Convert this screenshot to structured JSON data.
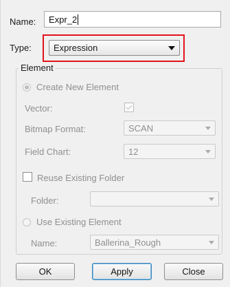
{
  "form": {
    "name_label": "Name:",
    "name_value": "Expr_2",
    "type_label": "Type:",
    "type_value": "Expression",
    "highlight_color": "#e3111b"
  },
  "element_group": {
    "title": "Element",
    "create_new_label": "Create New Element",
    "create_new_selected": true,
    "vector_label": "Vector:",
    "vector_checked": true,
    "bitmap_format_label": "Bitmap Format:",
    "bitmap_format_value": "SCAN",
    "field_chart_label": "Field Chart:",
    "field_chart_value": "12",
    "reuse_folder_label": "Reuse Existing Folder",
    "reuse_folder_checked": false,
    "folder_label": "Folder:",
    "folder_value": "",
    "use_existing_label": "Use Existing Element",
    "use_existing_selected": false,
    "element_name_label": "Name:",
    "element_name_value": "Ballerina_Rough"
  },
  "buttons": {
    "ok": "OK",
    "apply": "Apply",
    "close": "Close"
  }
}
